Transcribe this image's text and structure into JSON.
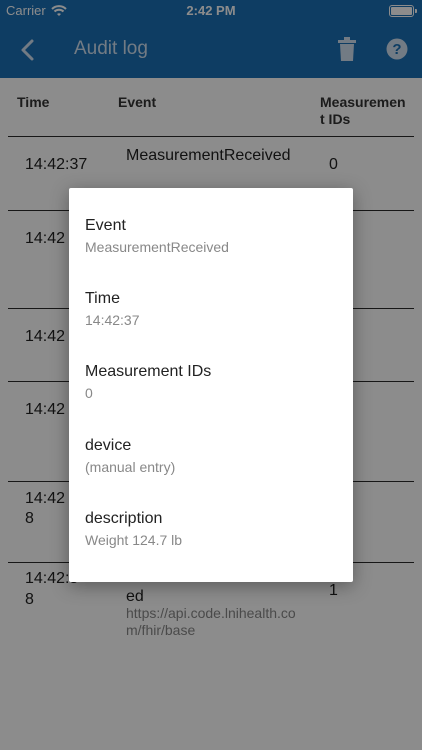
{
  "status_bar": {
    "carrier": "Carrier",
    "time": "2:42 PM"
  },
  "nav": {
    "title": "Audit log",
    "back_icon": "chevron-left-icon",
    "trash_icon": "trash-icon",
    "help_icon": "help-icon"
  },
  "table": {
    "headers": {
      "time": "Time",
      "event": "Event",
      "ids": "Measurement IDs"
    },
    "rows": [
      {
        "time": "14:42:37",
        "event": "MeasurementReceived",
        "ids": "0"
      },
      {
        "time": "14:42",
        "event": "",
        "ids": ""
      },
      {
        "time": "14:42",
        "event": "",
        "ids": ""
      },
      {
        "time": "14:42",
        "event": "",
        "ids": ""
      },
      {
        "time": "14:42",
        "time2": "8",
        "event": "",
        "ids": ""
      },
      {
        "time": "14:42:5",
        "time2": "8",
        "event": "ed",
        "event_sub": "https://api.code.lnihealth.com/fhir/base",
        "ids": "1"
      }
    ]
  },
  "dialog": {
    "fields": [
      {
        "label": "Event",
        "value": "MeasurementReceived"
      },
      {
        "label": "Time",
        "value": "14:42:37"
      },
      {
        "label": "Measurement IDs",
        "value": "0"
      },
      {
        "label": "device",
        "value": "(manual entry)"
      },
      {
        "label": "description",
        "value": "Weight 124.7 lb"
      }
    ]
  },
  "colors": {
    "nav_bg": "#1a6fb5",
    "overlay": "rgba(0,0,0,0.45)"
  }
}
